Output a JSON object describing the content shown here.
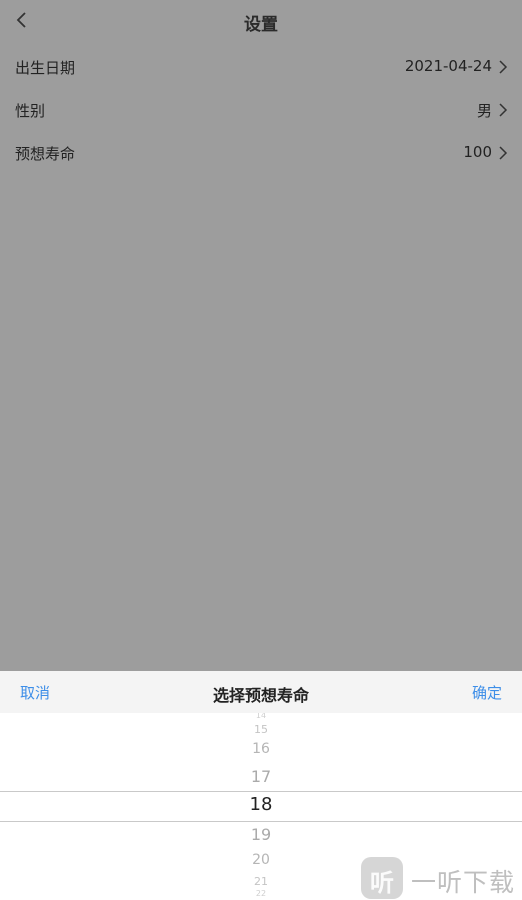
{
  "header": {
    "title": "设置",
    "back_icon": "chevron-left-icon"
  },
  "settings": {
    "rows": [
      {
        "label": "出生日期",
        "value": "2021-04-24"
      },
      {
        "label": "性别",
        "value": "男"
      },
      {
        "label": "预想寿命",
        "value": "100"
      }
    ],
    "chevron_icon": "chevron-right-icon"
  },
  "sheet": {
    "cancel_label": "取消",
    "title": "选择预想寿命",
    "confirm_label": "确定",
    "accent_color": "#3d8ee8",
    "picker": {
      "items": [
        "14",
        "15",
        "16",
        "17",
        "18",
        "19",
        "20",
        "21",
        "22"
      ],
      "selected": "18"
    }
  },
  "watermark": {
    "badge_text": "听",
    "text": "一听下载"
  }
}
